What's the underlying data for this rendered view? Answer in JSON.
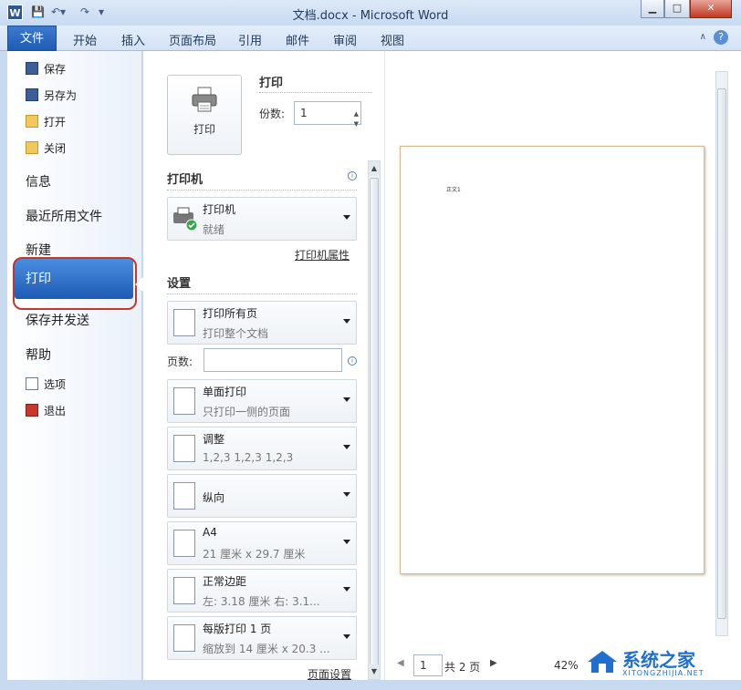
{
  "window": {
    "title": "文档.docx - Microsoft Word",
    "app_icon": "W",
    "controls": [
      "minimize-icon",
      "maximize-icon",
      "close-icon"
    ]
  },
  "ribbon": {
    "file_tab": "文件",
    "tabs": [
      "开始",
      "插入",
      "页面布局",
      "引用",
      "邮件",
      "审阅",
      "视图"
    ],
    "help": "?"
  },
  "backstage": {
    "small_items": [
      {
        "label": "保存",
        "icon": "save-icon"
      },
      {
        "label": "另存为",
        "icon": "save-as-icon"
      },
      {
        "label": "打开",
        "icon": "folder-open-icon"
      },
      {
        "label": "关闭",
        "icon": "folder-close-icon"
      }
    ],
    "large_items": [
      "信息",
      "最近所用文件",
      "新建",
      "打印",
      "保存并发送",
      "帮助"
    ],
    "selected": "打印",
    "bottom_items": [
      {
        "label": "选项",
        "icon": "options-icon"
      },
      {
        "label": "退出",
        "icon": "exit-icon"
      }
    ]
  },
  "print": {
    "button_label": "打印",
    "section_title": "打印",
    "copies_label": "份数:",
    "copies_value": "1",
    "printer_section": "打印机",
    "printer_name": "打印机",
    "printer_status": "就绪",
    "printer_props_link": "打印机属性",
    "settings_section": "设置",
    "pages_label": "页数:",
    "pages_value": "",
    "page_setup_link": "页面设置",
    "settings": [
      {
        "title": "打印所有页",
        "sub": "打印整个文档",
        "icon": "pages-icon"
      },
      {
        "title": "单面打印",
        "sub": "只打印一侧的页面",
        "icon": "one-sided-icon"
      },
      {
        "title": "调整",
        "sub": "1,2,3    1,2,3    1,2,3",
        "icon": "collate-icon"
      },
      {
        "title": "纵向",
        "sub": "",
        "icon": "portrait-icon"
      },
      {
        "title": "A4",
        "sub": "21 厘米 x 29.7 厘米",
        "icon": "paper-size-icon"
      },
      {
        "title": "正常边距",
        "sub": "左: 3.18 厘米    右: 3.1...",
        "icon": "margins-icon"
      },
      {
        "title": "每版打印 1 页",
        "sub": "缩放到 14 厘米 x 20.3 ...",
        "icon": "pages-per-sheet-icon"
      }
    ]
  },
  "preview": {
    "page_text": "正文1",
    "current_page": "1",
    "total_pages": "共 2 页",
    "zoom": "42%"
  },
  "watermark": {
    "brand": "系统之家",
    "url": "XITONGZHIJIA.NET"
  }
}
